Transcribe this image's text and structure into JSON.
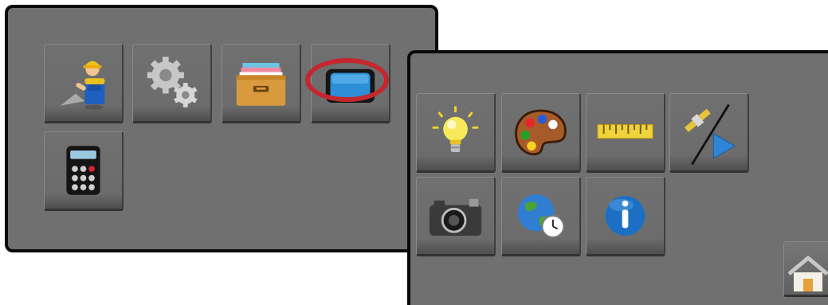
{
  "left_menu": {
    "tiles": [
      {
        "id": "setup",
        "icon": "worker-icon"
      },
      {
        "id": "settings",
        "icon": "gears-icon"
      },
      {
        "id": "data",
        "icon": "file-drawer-icon"
      },
      {
        "id": "display",
        "icon": "monitor-icon",
        "highlighted": true
      },
      {
        "id": "calculator",
        "icon": "calculator-icon"
      }
    ],
    "highlight_color": "#c4272e"
  },
  "right_menu": {
    "tiles": [
      {
        "id": "brightness",
        "icon": "lightbulb-icon"
      },
      {
        "id": "color-scheme",
        "icon": "palette-icon"
      },
      {
        "id": "units",
        "icon": "ruler-icon"
      },
      {
        "id": "gnss-guidance",
        "icon": "satellite-play-icon"
      },
      {
        "id": "screenshot",
        "icon": "camera-icon"
      },
      {
        "id": "region-time",
        "icon": "globe-clock-icon"
      },
      {
        "id": "about",
        "icon": "info-icon"
      }
    ]
  },
  "home_button": {
    "icon": "home-icon"
  },
  "colors": {
    "panel_background": "#707070",
    "panel_border": "#0a0a0a",
    "accent_blue": "#2f8fd6"
  }
}
